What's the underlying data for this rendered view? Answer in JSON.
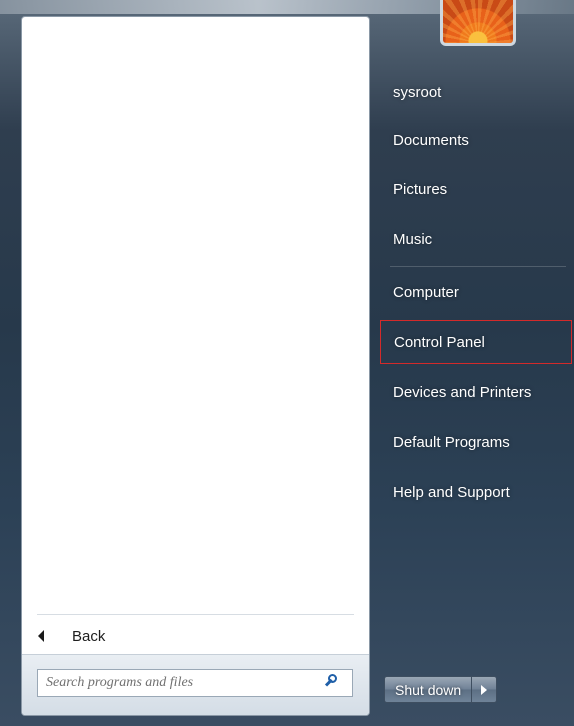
{
  "left_pane": {
    "back_label": "Back",
    "search": {
      "placeholder": "Search programs and files",
      "value": "",
      "icon": "search-icon"
    },
    "back_icon": "left-triangle-arrow-icon"
  },
  "user": {
    "picture": "orange-flower-user-picture"
  },
  "right_pane": {
    "items": [
      {
        "label": "sysroot"
      },
      {
        "label": "Documents"
      },
      {
        "label": "Pictures"
      },
      {
        "label": "Music"
      },
      {
        "label": "Computer"
      },
      {
        "label": "Control Panel",
        "selected": true,
        "highlight_color": "#d42a2a"
      },
      {
        "label": "Devices and Printers"
      },
      {
        "label": "Default Programs"
      },
      {
        "label": "Help and Support"
      }
    ]
  },
  "shutdown": {
    "label": "Shut down",
    "arrow_icon": "right-triangle-icon"
  }
}
